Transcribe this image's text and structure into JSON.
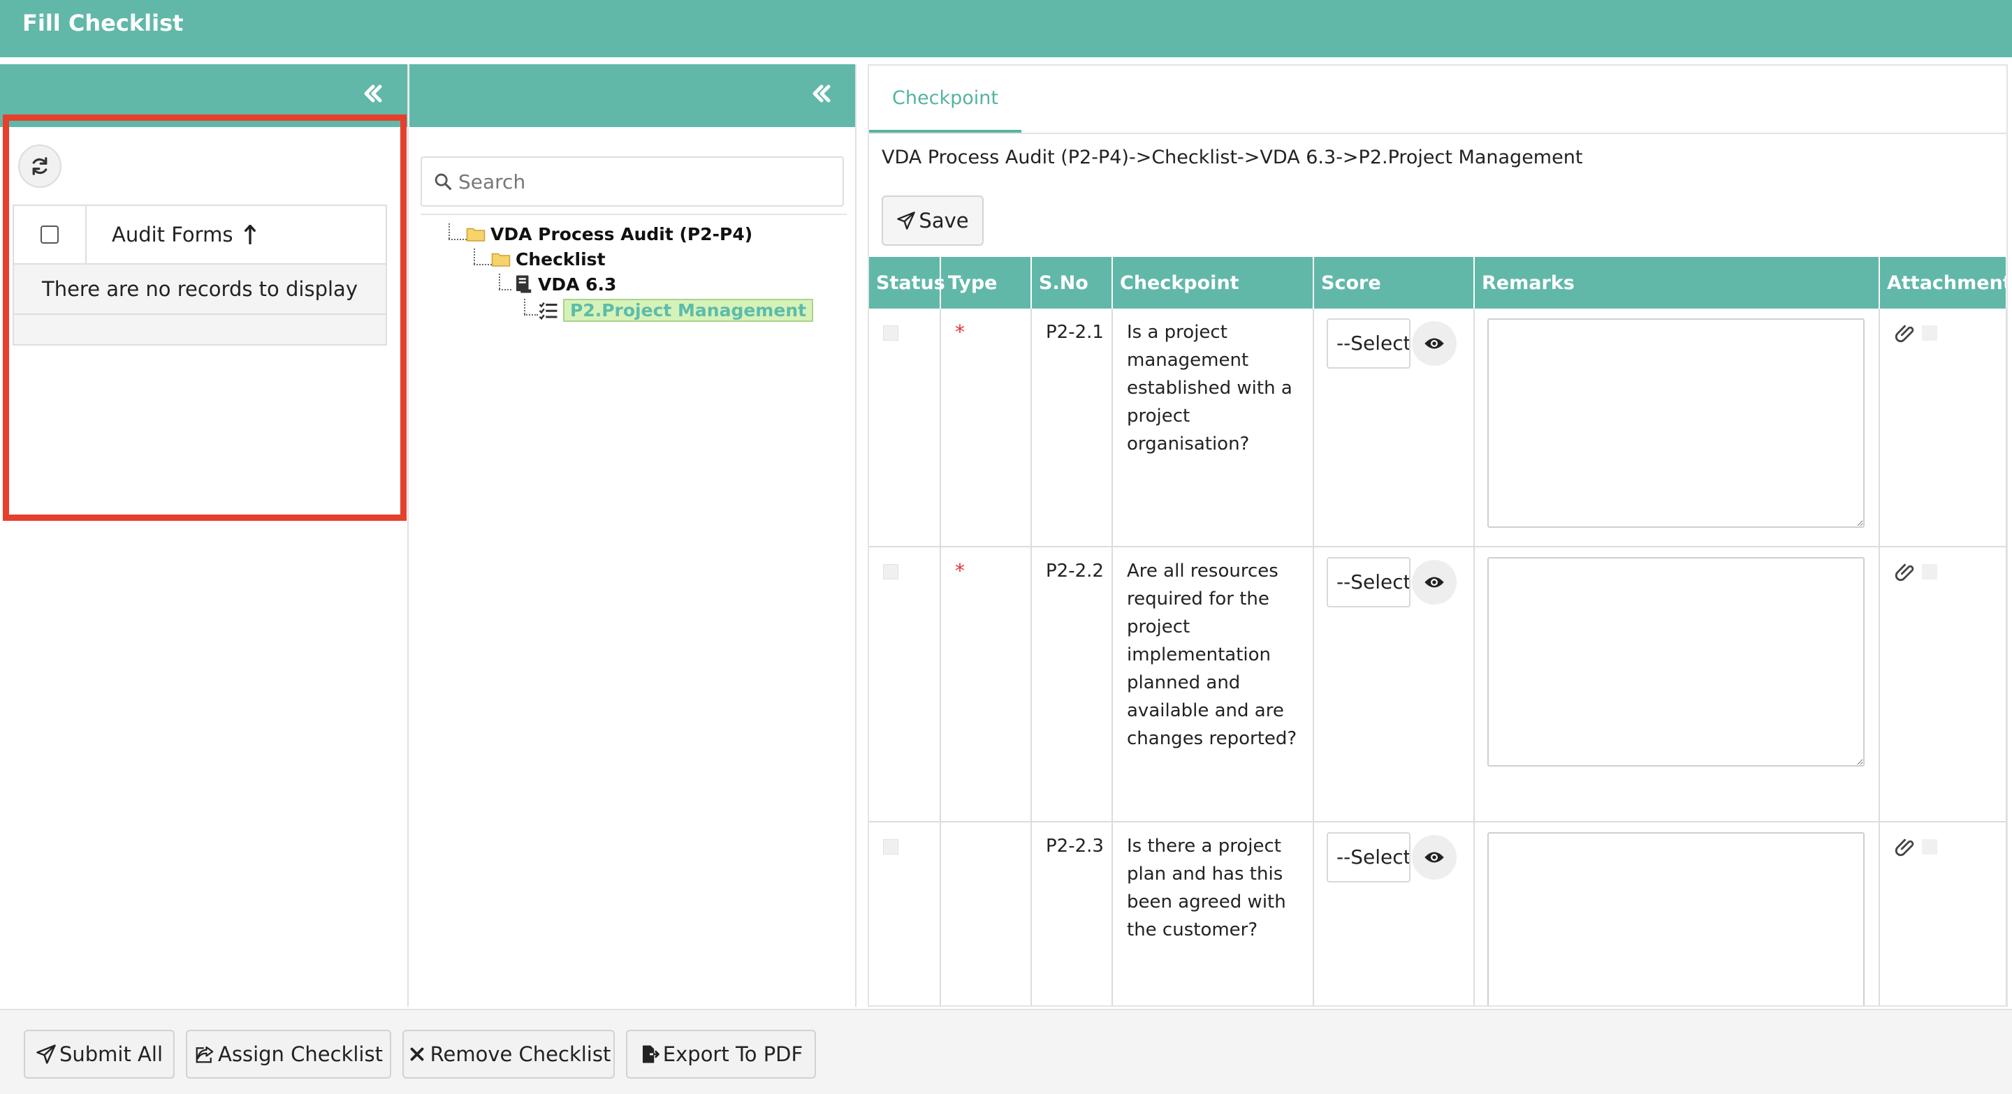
{
  "window": {
    "title": "Fill Checklist"
  },
  "colors": {
    "header": "#61b8a8",
    "accent": "#55b3a2",
    "highlight": "#e4402c",
    "required": "#e03333"
  },
  "left_panel": {
    "collapse_icon": "double-chevron-left-icon",
    "refresh_icon": "refresh-icon",
    "grid": {
      "column": "Audit Forms",
      "sort": "ascending",
      "empty_message": "There are no records to display"
    }
  },
  "middle_panel": {
    "search_placeholder": "Search",
    "tree": [
      {
        "label": "VDA Process Audit (P2-P4)",
        "icon": "folder-icon"
      },
      {
        "label": "Checklist",
        "icon": "folder-icon"
      },
      {
        "label": "VDA 6.3",
        "icon": "document-icon"
      },
      {
        "label": "P2.Project Management",
        "icon": "checklist-icon",
        "selected": true
      }
    ]
  },
  "right_panel": {
    "tab": "Checkpoint",
    "breadcrumb": "VDA Process Audit (P2-P4)->Checklist->VDA 6.3->P2.Project Management",
    "save_label": "Save",
    "columns": [
      "Status",
      "Type",
      "S.No",
      "Checkpoint",
      "Score",
      "Remarks",
      "Attachments"
    ],
    "rows": [
      {
        "required": "*",
        "sno": "P2-2.1",
        "checkpoint": "Is a project management established with a project organisation?",
        "score": "--Select--"
      },
      {
        "required": "*",
        "sno": "P2-2.2",
        "checkpoint": "Are all resources required for the project implementation planned and available and are changes reported?",
        "score": "--Select--"
      },
      {
        "required": "",
        "sno": "P2-2.3",
        "checkpoint": "Is there a project plan and has this been agreed with the customer?",
        "score": "--Select--"
      }
    ]
  },
  "bottom_bar": {
    "submit_all": "Submit All",
    "assign_checklist": "Assign Checklist",
    "remove_checklist": "Remove Checklist",
    "export_pdf": "Export To PDF"
  }
}
